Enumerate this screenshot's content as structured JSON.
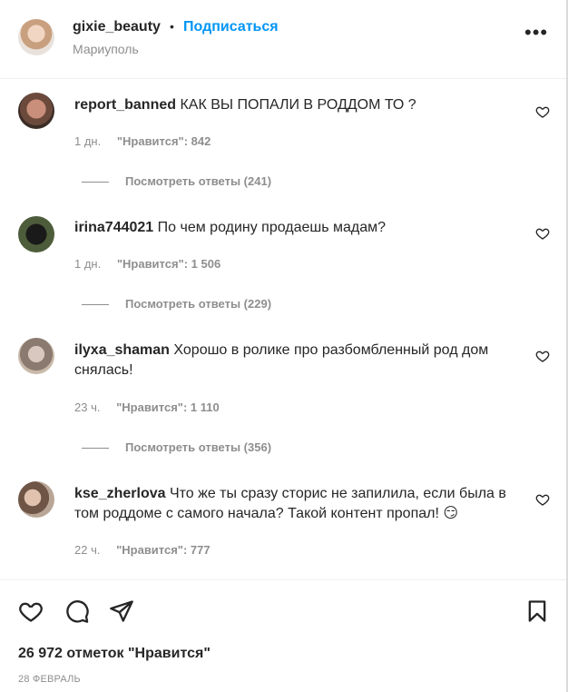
{
  "header": {
    "username": "gixie_beauty",
    "separator": "•",
    "follow_label": "Подписаться",
    "location": "Мариуполь",
    "more_label": "•••"
  },
  "comments": [
    {
      "username": "report_banned",
      "text": "КАК ВЫ ПОПАЛИ В РОДДОМ ТО ?",
      "time": "1 дн.",
      "likes": "\"Нравится\": 842",
      "replies": "Посмотреть ответы (241)"
    },
    {
      "username": "irina744021",
      "text": "По чем родину продаешь мадам?",
      "time": "1 дн.",
      "likes": "\"Нравится\": 1 506",
      "replies": "Посмотреть ответы (229)"
    },
    {
      "username": "ilyxa_shaman",
      "text": "Хорошо в ролике про разбомбленный род дом снялась!",
      "time": "23 ч.",
      "likes": "\"Нравится\": 1 110",
      "replies": "Посмотреть ответы (356)"
    },
    {
      "username": "kse_zherlova",
      "text": "Что же ты сразу сторис не запилила, если была в том роддоме с самого начала? Такой контент пропал!",
      "emoji": "😏",
      "time": "22 ч.",
      "likes": "\"Нравится\": 777"
    }
  ],
  "actions": {
    "like_icon": "heart-icon",
    "comment_icon": "comment-icon",
    "share_icon": "share-icon",
    "save_icon": "bookmark-icon"
  },
  "likes_total": "26 972 отметок \"Нравится\"",
  "post_date": "28 ФЕВРАЛЬ",
  "colors": {
    "accent": "#0095f6",
    "text": "#262626",
    "secondary": "#8e8e8e"
  }
}
